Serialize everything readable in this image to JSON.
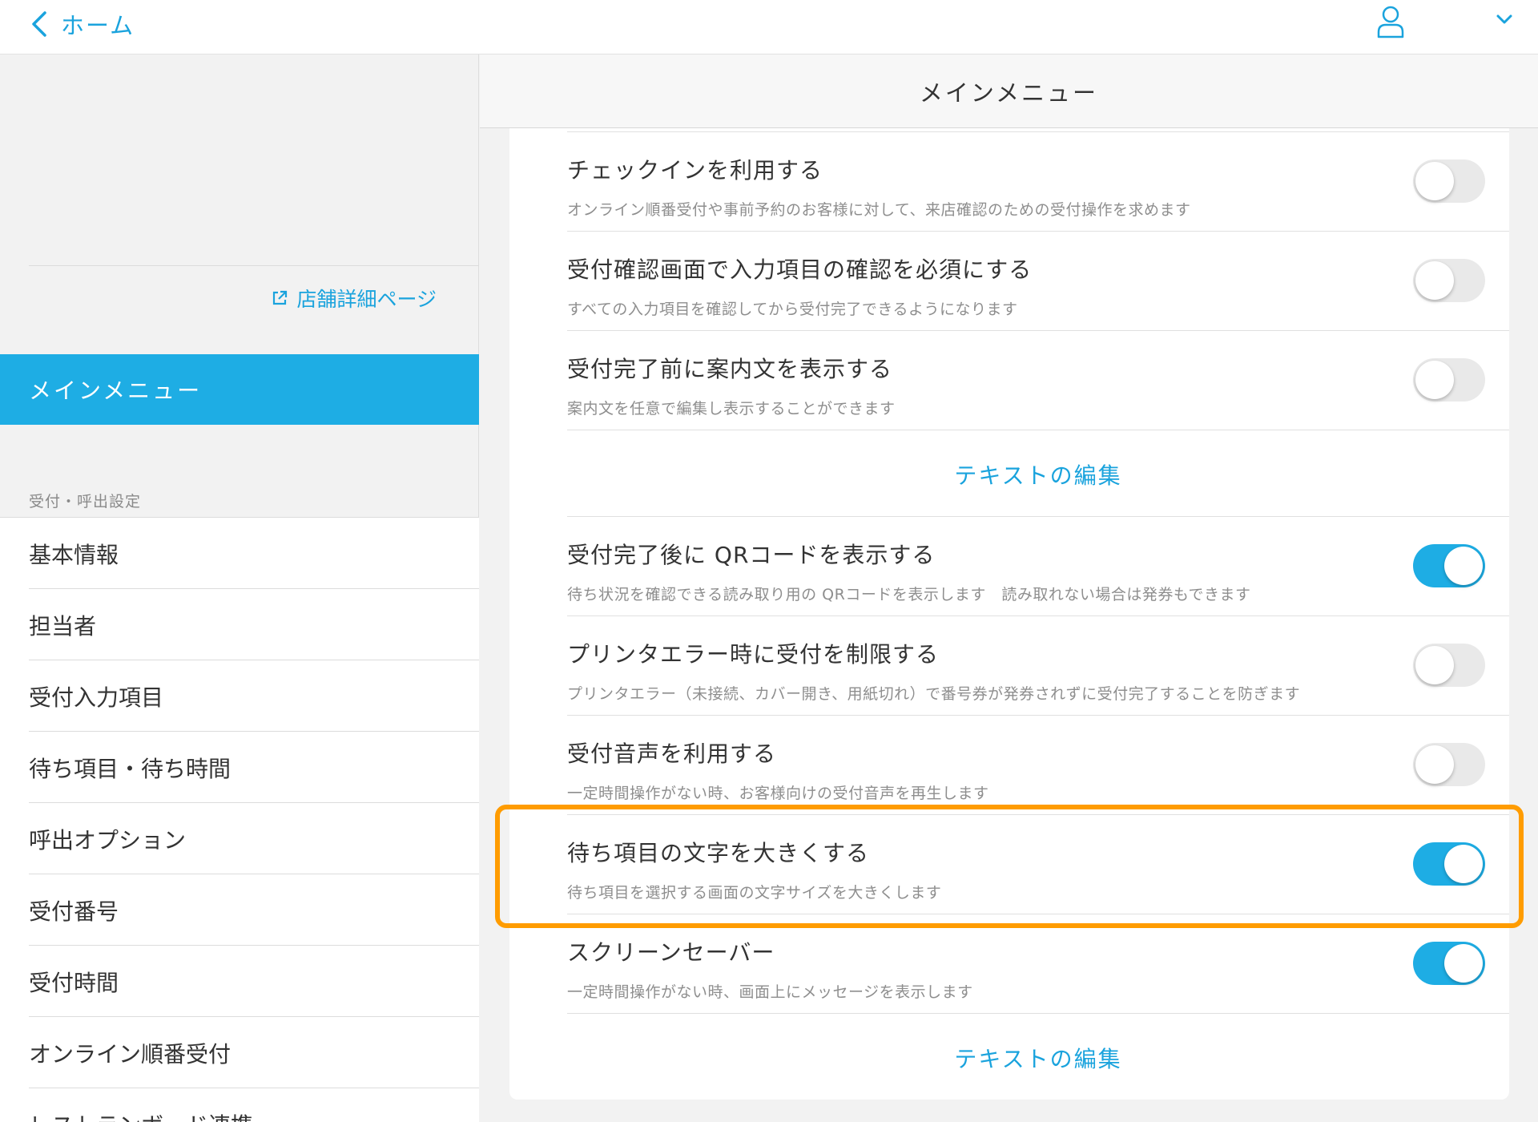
{
  "topbar": {
    "back_label": "ホーム"
  },
  "sidebar": {
    "store_link": "店舗詳細ページ",
    "active_item": "メインメニュー",
    "section_label": "受付・呼出設定",
    "items": [
      "基本情報",
      "担当者",
      "受付入力項目",
      "待ち項目・待ち時間",
      "呼出オプション",
      "受付番号",
      "受付時間",
      "オンライン順番受付",
      "レストランボード連携"
    ]
  },
  "main": {
    "title": "メインメニュー",
    "settings": [
      {
        "title": "チェックインを利用する",
        "desc": "オンライン順番受付や事前予約のお客様に対して、来店確認のための受付操作を求めます",
        "enabled": false
      },
      {
        "title": "受付確認画面で入力項目の確認を必須にする",
        "desc": "すべての入力項目を確認してから受付完了できるようになります",
        "enabled": false
      },
      {
        "title": "受付完了前に案内文を表示する",
        "desc": "案内文を任意で編集し表示することができます",
        "enabled": false
      },
      {
        "title": "受付完了後に QRコードを表示する",
        "desc": "待ち状況を確認できる読み取り用の QRコードを表示します　読み取れない場合は発券もできます",
        "enabled": true
      },
      {
        "title": "プリンタエラー時に受付を制限する",
        "desc": "プリンタエラー（未接続、カバー開き、用紙切れ）で番号券が発券されずに受付完了することを防ぎます",
        "enabled": false
      },
      {
        "title": "受付音声を利用する",
        "desc": "一定時間操作がない時、お客様向けの受付音声を再生します",
        "enabled": false
      },
      {
        "title": "待ち項目の文字を大きくする",
        "desc": "待ち項目を選択する画面の文字サイズを大きくします",
        "enabled": true
      },
      {
        "title": "スクリーンセーバー",
        "desc": "一定時間操作がない時、画面上にメッセージを表示します",
        "enabled": true
      }
    ],
    "edit_text_label": "テキストの編集"
  },
  "colors": {
    "accent": "#1eade4",
    "highlight": "#ff9c00"
  }
}
